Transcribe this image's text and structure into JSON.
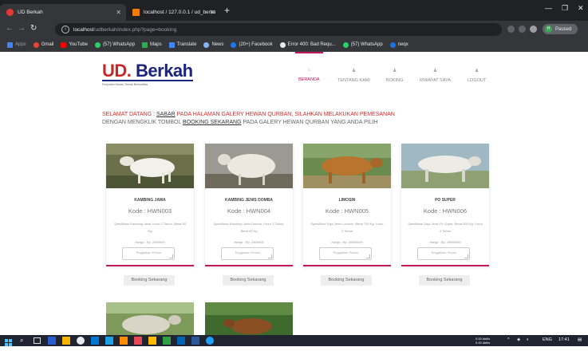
{
  "browser": {
    "tabs": [
      {
        "title": "UD Berkah",
        "active": true
      },
      {
        "title": "localhost / 127.0.0.1 / ud_berkah",
        "active": false
      }
    ],
    "url_host": "localhost",
    "url_path": "/udberkah/index.php?page=booking",
    "profile_status": "Paused",
    "profile_initial": "H",
    "bookmarks": [
      "Apps",
      "Gmail",
      "YouTube",
      "(57) WhatsApp",
      "Maps",
      "Translate",
      "News",
      "(20+) Facebook",
      "Error 400: Bad Requ...",
      "(57) WhatsApp",
      "neqx"
    ]
  },
  "site": {
    "logo_main": "UD.",
    "logo_rest": " Berkah",
    "logo_tagline": "Penjualan Hewan Ternak Berkualitas",
    "nav": [
      {
        "label": "BERANDA",
        "active": true
      },
      {
        "label": "TENTANG KAMI",
        "active": false
      },
      {
        "label": "BOKING",
        "active": false
      },
      {
        "label": "RIWAYAT SAYA",
        "active": false
      },
      {
        "label": "LOGOUT",
        "active": false
      }
    ]
  },
  "welcome": {
    "prefix": "SELAMAT DATANG : ",
    "username": "SABAR",
    "line1": " PADA HALAMAN GALERY HEWAN QURBAN, SILAHKAN MELAKUKAN PEMESANAN",
    "line2a": "DENGAN MENGKLIK TOMBOL ",
    "link": "BOOKING SEKARANG",
    "line2b": " PADA GALERY HEWAN QURBAN YANG ANDA PILIH"
  },
  "cards": [
    {
      "title": "KAMBING JAWA",
      "kode": "Kode : HWN003",
      "spec": "Spesifikasi Kambing Jawa Umur 2 Tahun, Berat 50 Kg",
      "harga": "Harga : Rp. 2000000",
      "textarea_placeholder": "Tinggalkan Pesan",
      "button": "Booking Sekarang"
    },
    {
      "title": "KAMBING JENIS DOMBA",
      "kode": "Kode : HWN004",
      "spec": "Spesifikasi Kambing Jenis Domba, Umur 2 Tahun, Berat 60 Kg",
      "harga": "Harga : Rp. 2500000",
      "textarea_placeholder": "Tinggalkan Pesan",
      "button": "Booking Sekarang"
    },
    {
      "title": "LIMOSIN",
      "kode": "Kode : HWN005",
      "spec": "Spesifikasi Sapi Jenis Limosin, Berat 700 Kg, Umur 3 Tahun",
      "harga": "Harga : Rp. 45000000",
      "textarea_placeholder": "Tinggalkan Pesan",
      "button": "Booking Sekarang"
    },
    {
      "title": "PO SUPER",
      "kode": "Kode : HWN006",
      "spec": "Spesifikasi Sapi Jenis Po Super, Berat 800 Kg, Umur 4 Tahun",
      "harga": "Harga : Rp. 28000000",
      "textarea_placeholder": "Tinggalkan Pesan",
      "button": "Booking Sekarang"
    }
  ],
  "taskbar": {
    "network_up": "0.00 kbit/s",
    "network_down": "0.00 kbit/s",
    "language": "ENG",
    "time": "17:41"
  }
}
